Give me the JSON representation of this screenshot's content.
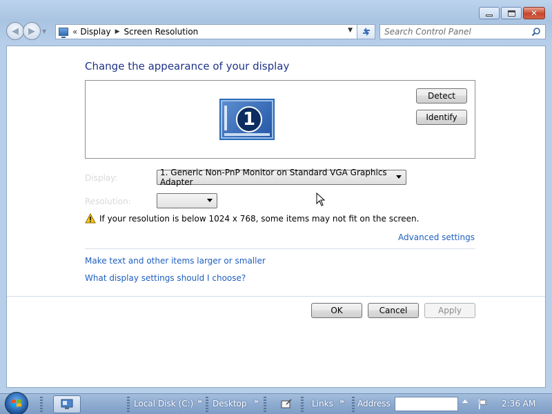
{
  "window": {
    "breadcrumb": {
      "part1": "Display",
      "part2": "Screen Resolution"
    },
    "search_placeholder": "Search Control Panel"
  },
  "main": {
    "title": "Change the appearance of your display",
    "monitor_number": "1",
    "detect_label": "Detect",
    "identify_label": "Identify",
    "display_label": "Display:",
    "display_value": "1. Generic Non-PnP Monitor on Standard VGA Graphics Adapter",
    "resolution_label": "Resolution:",
    "warning_text": "If your resolution is below 1024 x 768, some items may not fit on the screen.",
    "advanced_link": "Advanced settings",
    "link_text_size": "Make text and other items larger or smaller",
    "link_help": "What display settings should I choose?",
    "ok_label": "OK",
    "cancel_label": "Cancel",
    "apply_label": "Apply"
  },
  "taskbar": {
    "local_disk": "Local Disk (C:)",
    "desktop": "Desktop",
    "links": "Links",
    "address": "Address",
    "clock": "2:36 AM"
  },
  "icons": {
    "start": "windows-orb-icon",
    "warning": "warning-icon",
    "search": "search-icon",
    "refresh": "refresh-icon"
  },
  "colors": {
    "title": "#1e3287",
    "link": "#1e5fbf",
    "close_button": "#c8452a"
  }
}
